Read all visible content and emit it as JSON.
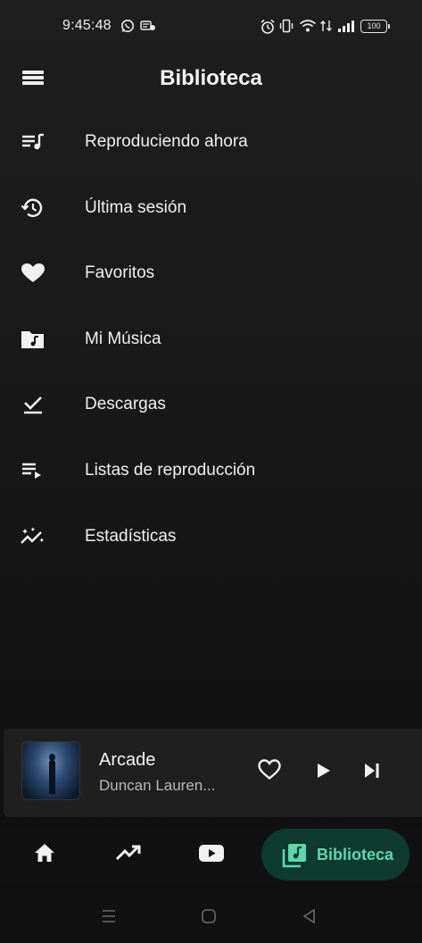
{
  "status_bar": {
    "time": "9:45:48",
    "battery": "100",
    "icons": [
      "whatsapp-icon",
      "notification-icon",
      "alarm-icon",
      "vibrate-icon",
      "wifi-icon",
      "signal-icon"
    ]
  },
  "header": {
    "title": "Biblioteca",
    "menu_icon": "menu-icon"
  },
  "library": {
    "items": [
      {
        "label": "Reproduciendo ahora",
        "icon": "queue-music-icon"
      },
      {
        "label": "Última sesión",
        "icon": "history-icon"
      },
      {
        "label": "Favoritos",
        "icon": "heart-icon"
      },
      {
        "label": "Mi Música",
        "icon": "music-folder-icon"
      },
      {
        "label": "Descargas",
        "icon": "download-done-icon"
      },
      {
        "label": "Listas de reproducción",
        "icon": "playlist-play-icon"
      },
      {
        "label": "Estadísticas",
        "icon": "stats-icon"
      }
    ]
  },
  "mini_player": {
    "title": "Arcade",
    "artist": "Duncan Lauren...",
    "controls": [
      "heart-outline-icon",
      "play-icon",
      "skip-next-icon"
    ]
  },
  "bottom_nav": {
    "items": [
      {
        "icon": "home-icon"
      },
      {
        "icon": "trending-icon"
      },
      {
        "icon": "youtube-icon"
      },
      {
        "icon": "library-music-icon",
        "label": "Biblioteca",
        "active": true
      }
    ],
    "active_color": "#5fd6ab",
    "active_bg": "#0f3a30"
  },
  "system_nav": [
    "recent-apps-icon",
    "home-circle-icon",
    "back-icon"
  ]
}
